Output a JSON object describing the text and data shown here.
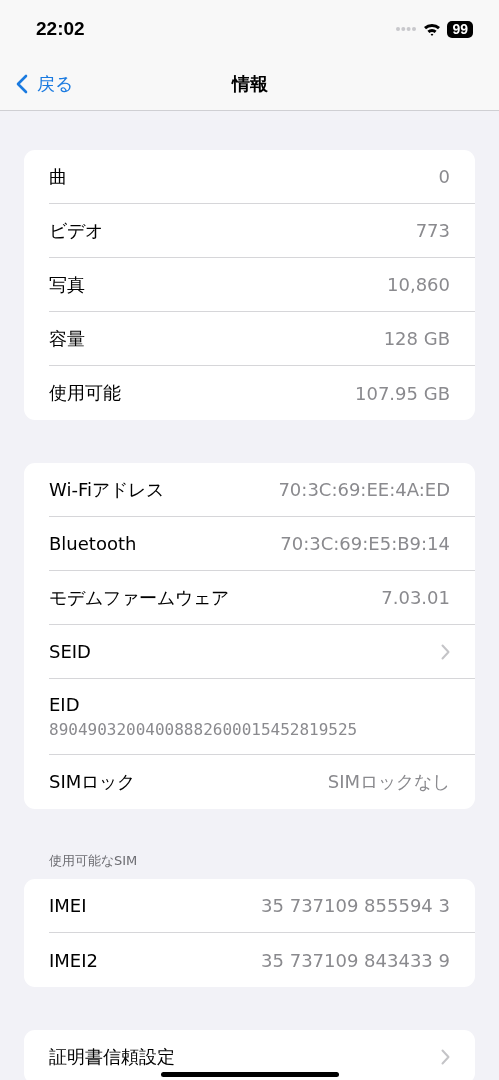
{
  "status_bar": {
    "time": "22:02",
    "battery": "99"
  },
  "nav": {
    "back": "戻る",
    "title": "情報"
  },
  "groups": [
    {
      "rows": [
        {
          "kind": "value",
          "label": "曲",
          "value": "0"
        },
        {
          "kind": "value",
          "label": "ビデオ",
          "value": "773"
        },
        {
          "kind": "value",
          "label": "写真",
          "value": "10,860"
        },
        {
          "kind": "value",
          "label": "容量",
          "value": "128 GB"
        },
        {
          "kind": "value",
          "label": "使用可能",
          "value": "107.95 GB"
        }
      ]
    },
    {
      "rows": [
        {
          "kind": "value",
          "label": "Wi-Fiアドレス",
          "value": "70:3C:69:EE:4A:ED"
        },
        {
          "kind": "value",
          "label": "Bluetooth",
          "value": "70:3C:69:E5:B9:14"
        },
        {
          "kind": "value",
          "label": "モデムファームウェア",
          "value": "7.03.01"
        },
        {
          "kind": "chevron",
          "label": "SEID"
        },
        {
          "kind": "stacked",
          "label": "EID",
          "value": "89049032004008882600015452819525"
        },
        {
          "kind": "value",
          "label": "SIMロック",
          "value": "SIMロックなし"
        }
      ]
    },
    {
      "header": "使用可能なSIM",
      "rows": [
        {
          "kind": "value",
          "label": "IMEI",
          "value": "35 737109 855594 3"
        },
        {
          "kind": "value",
          "label": "IMEI2",
          "value": "35 737109 843433 9"
        }
      ]
    },
    {
      "rows": [
        {
          "kind": "chevron",
          "label": "証明書信頼設定"
        }
      ]
    }
  ]
}
